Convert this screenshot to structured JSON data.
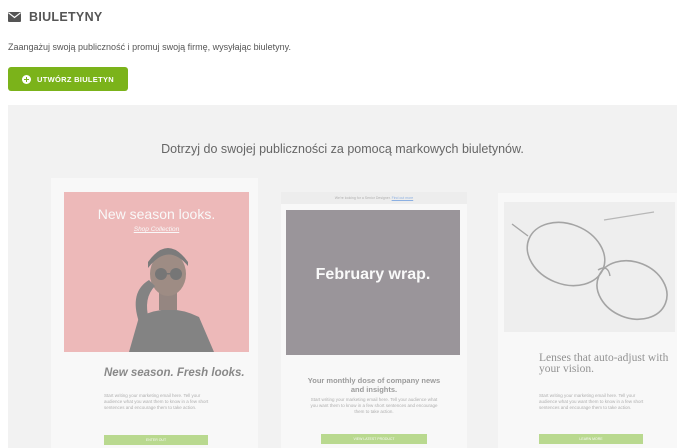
{
  "header": {
    "title": "BIULETYNY",
    "icon": "envelope-icon"
  },
  "description": "Zaangażuj swoją publiczność i promuj swoją firmę, wysyłając biuletyny.",
  "create_button": {
    "label": "UTWÓRZ BIULETYN",
    "icon": "plus-circle-icon",
    "color": "#7bb31a"
  },
  "promo": {
    "heading": "Dotrzyj do swojej publiczności za pomocą markowych biuletynów.",
    "cards": [
      {
        "image_title": "New season looks.",
        "image_subtitle": "Shop Collection",
        "heading": "New season. Fresh looks.",
        "body": "Start writing your marketing email here. Tell your audience what you want them to know in a few short sentences and encourage them to take action.",
        "button": "ENTER OUT",
        "image_color": "#e98b8b"
      },
      {
        "top_text": "We're looking for a Senior Designer.",
        "top_link": "Find out more",
        "image_title": "February wrap.",
        "heading": "Your monthly dose of company news and insights.",
        "body": "Start writing your marketing email here. Tell your audience what you want them to know in a few short sentences and encourage them to take action.",
        "button": "VIEW LATEST PRODUCT",
        "image_color": "#544a54"
      },
      {
        "heading": "Lenses that auto-adjust with your vision.",
        "body": "Start writing your marketing email here. Tell your audience what you want them to know in a few short sentences and encourage them to take action.",
        "button": "LEARN MORE"
      }
    ]
  }
}
